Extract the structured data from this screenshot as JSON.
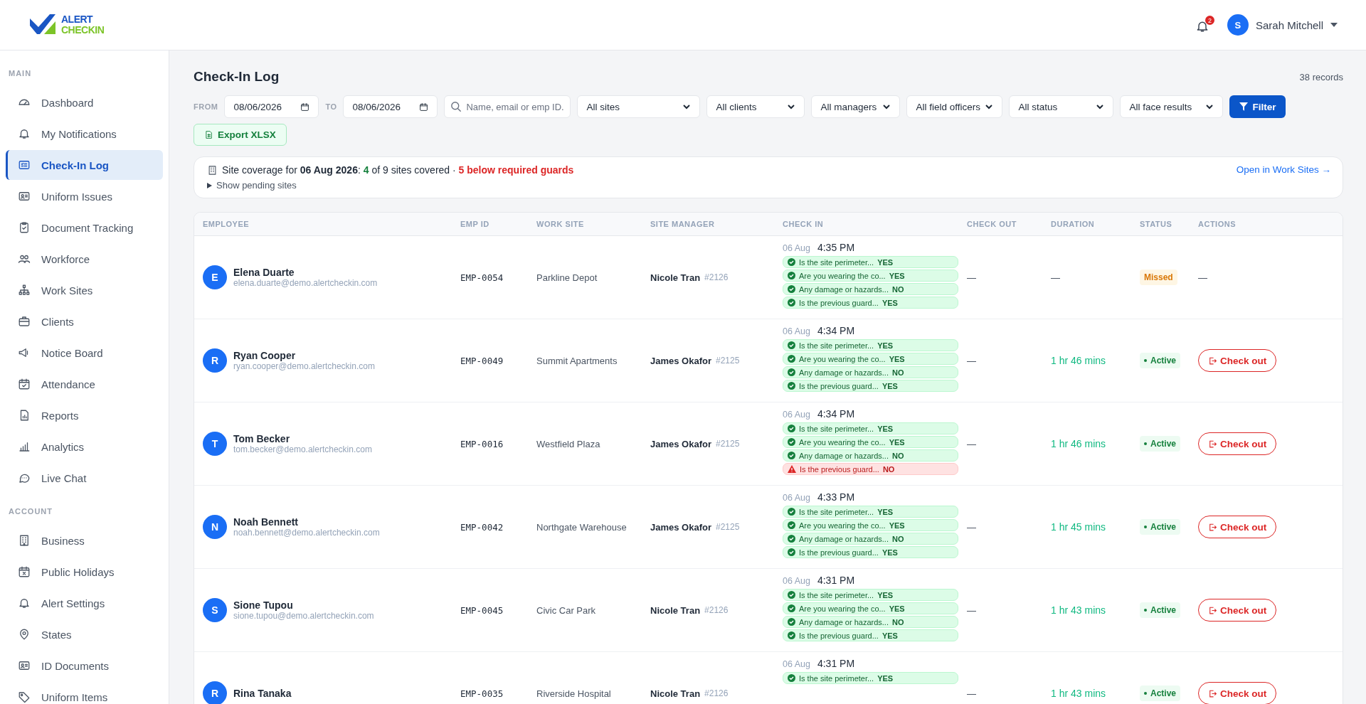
{
  "logo": {
    "line1": "ALERT",
    "line2": "CHECKIN"
  },
  "header": {
    "notification_count": "2",
    "user": {
      "initial": "S",
      "name": "Sarah Mitchell"
    }
  },
  "sidebar": {
    "sections": [
      {
        "title": "MAIN",
        "items": [
          {
            "label": "Dashboard",
            "selected": false
          },
          {
            "label": "My Notifications",
            "selected": false
          },
          {
            "label": "Check-In Log",
            "selected": true
          },
          {
            "label": "Uniform Issues",
            "selected": false
          },
          {
            "label": "Document Tracking",
            "selected": false
          },
          {
            "label": "Workforce",
            "selected": false
          },
          {
            "label": "Work Sites",
            "selected": false
          },
          {
            "label": "Clients",
            "selected": false
          },
          {
            "label": "Notice Board",
            "selected": false
          },
          {
            "label": "Attendance",
            "selected": false
          },
          {
            "label": "Reports",
            "selected": false
          },
          {
            "label": "Analytics",
            "selected": false
          },
          {
            "label": "Live Chat",
            "selected": false
          }
        ]
      },
      {
        "title": "ACCOUNT",
        "items": [
          {
            "label": "Business",
            "selected": false
          },
          {
            "label": "Public Holidays",
            "selected": false
          },
          {
            "label": "Alert Settings",
            "selected": false
          },
          {
            "label": "States",
            "selected": false
          },
          {
            "label": "ID Documents",
            "selected": false
          },
          {
            "label": "Uniform Items",
            "selected": false
          }
        ]
      }
    ]
  },
  "page": {
    "title": "Check-In Log",
    "record_count": "38 records"
  },
  "filters": {
    "from_label": "FROM",
    "from_value": "08/06/2026",
    "to_label": "TO",
    "to_value": "08/06/2026",
    "search_placeholder": "Name, email or emp ID.",
    "dropdowns": [
      "All sites",
      "All clients",
      "All managers",
      "All field officers",
      "All status",
      "All face results"
    ],
    "filter_button": "Filter",
    "export_button": "Export XLSX"
  },
  "coverage": {
    "text": "Site coverage for **06 Aug 2026**:",
    "covered": "4",
    "of_text": "of 9 sites covered ·",
    "below": "5 below required guards",
    "toggle": "Show pending sites",
    "link": "Open in Work Sites →"
  },
  "table": {
    "columns": [
      "EMPLOYEE",
      "EMP ID",
      "WORK SITE",
      "SITE MANAGER",
      "CHECK IN",
      "CHECK OUT",
      "DURATION",
      "STATUS",
      "ACTIONS"
    ],
    "rows": [
      {
        "initial": "E",
        "name": "Elena Duarte",
        "email": "elena.duarte@demo.alertcheckin.com",
        "emp_id": "EMP-0054",
        "site": "Parkline Depot",
        "manager": "Nicole Tran",
        "manager_id": "#2126",
        "date": "06 Aug",
        "time": "4:35 PM",
        "answers": [
          {
            "question": "Is the site perimeter...",
            "answer": "YES",
            "ok": true
          },
          {
            "question": "Are you wearing the co...",
            "answer": "YES",
            "ok": true
          },
          {
            "question": "Any damage or hazards...",
            "answer": "NO",
            "ok": true
          },
          {
            "question": "Is the previous guard...",
            "answer": "YES",
            "ok": true
          }
        ],
        "check_out": "—",
        "duration": {
          "text": "—",
          "kind": "none"
        },
        "status": {
          "label": "Missed",
          "kind": "missed"
        },
        "action": {
          "kind": "none",
          "text": "—"
        }
      },
      {
        "initial": "R",
        "name": "Ryan Cooper",
        "email": "ryan.cooper@demo.alertcheckin.com",
        "emp_id": "EMP-0049",
        "site": "Summit Apartments",
        "manager": "James Okafor",
        "manager_id": "#2125",
        "date": "06 Aug",
        "time": "4:34 PM",
        "answers": [
          {
            "question": "Is the site perimeter...",
            "answer": "YES",
            "ok": true
          },
          {
            "question": "Are you wearing the co...",
            "answer": "YES",
            "ok": true
          },
          {
            "question": "Any damage or hazards...",
            "answer": "NO",
            "ok": true
          },
          {
            "question": "Is the previous guard...",
            "answer": "YES",
            "ok": true
          }
        ],
        "check_out": "—",
        "duration": {
          "text": "1 hr 46 mins",
          "kind": "live"
        },
        "status": {
          "label": "Active",
          "kind": "active"
        },
        "action": {
          "kind": "button",
          "text": "Check out"
        }
      },
      {
        "initial": "T",
        "name": "Tom Becker",
        "email": "tom.becker@demo.alertcheckin.com",
        "emp_id": "EMP-0016",
        "site": "Westfield Plaza",
        "manager": "James Okafor",
        "manager_id": "#2125",
        "date": "06 Aug",
        "time": "4:34 PM",
        "answers": [
          {
            "question": "Is the site perimeter...",
            "answer": "YES",
            "ok": true
          },
          {
            "question": "Are you wearing the co...",
            "answer": "YES",
            "ok": true
          },
          {
            "question": "Any damage or hazards...",
            "answer": "NO",
            "ok": true
          },
          {
            "question": "Is the previous guard...",
            "answer": "NO",
            "ok": false
          }
        ],
        "check_out": "—",
        "duration": {
          "text": "1 hr 46 mins",
          "kind": "live"
        },
        "status": {
          "label": "Active",
          "kind": "active"
        },
        "action": {
          "kind": "button",
          "text": "Check out"
        }
      },
      {
        "initial": "N",
        "name": "Noah Bennett",
        "email": "noah.bennett@demo.alertcheckin.com",
        "emp_id": "EMP-0042",
        "site": "Northgate Warehouse",
        "manager": "James Okafor",
        "manager_id": "#2125",
        "date": "06 Aug",
        "time": "4:33 PM",
        "answers": [
          {
            "question": "Is the site perimeter...",
            "answer": "YES",
            "ok": true
          },
          {
            "question": "Are you wearing the co...",
            "answer": "YES",
            "ok": true
          },
          {
            "question": "Any damage or hazards...",
            "answer": "NO",
            "ok": true
          },
          {
            "question": "Is the previous guard...",
            "answer": "YES",
            "ok": true
          }
        ],
        "check_out": "—",
        "duration": {
          "text": "1 hr 45 mins",
          "kind": "live"
        },
        "status": {
          "label": "Active",
          "kind": "active"
        },
        "action": {
          "kind": "button",
          "text": "Check out"
        }
      },
      {
        "initial": "S",
        "name": "Sione Tupou",
        "email": "sione.tupou@demo.alertcheckin.com",
        "emp_id": "EMP-0045",
        "site": "Civic Car Park",
        "manager": "Nicole Tran",
        "manager_id": "#2126",
        "date": "06 Aug",
        "time": "4:31 PM",
        "answers": [
          {
            "question": "Is the site perimeter...",
            "answer": "YES",
            "ok": true
          },
          {
            "question": "Are you wearing the co...",
            "answer": "YES",
            "ok": true
          },
          {
            "question": "Any damage or hazards...",
            "answer": "NO",
            "ok": true
          },
          {
            "question": "Is the previous guard...",
            "answer": "YES",
            "ok": true
          }
        ],
        "check_out": "—",
        "duration": {
          "text": "1 hr 43 mins",
          "kind": "live"
        },
        "status": {
          "label": "Active",
          "kind": "active"
        },
        "action": {
          "kind": "button",
          "text": "Check out"
        }
      },
      {
        "initial": "R",
        "name": "Rina Tanaka",
        "emp_id": "EMP-0035",
        "site": "Riverside Hospital",
        "manager": "Nicole Tran",
        "manager_id": "#2126",
        "date": "06 Aug",
        "time": "4:31 PM",
        "answers": [
          {
            "question": "Is the site perimeter...",
            "answer": "YES",
            "ok": true
          }
        ],
        "check_out": "—",
        "duration": {
          "text": "1 hr 43 mins",
          "kind": "live"
        },
        "status": {
          "label": "Active",
          "kind": "active"
        },
        "action": {
          "kind": "button",
          "text": "Check out"
        }
      }
    ]
  }
}
